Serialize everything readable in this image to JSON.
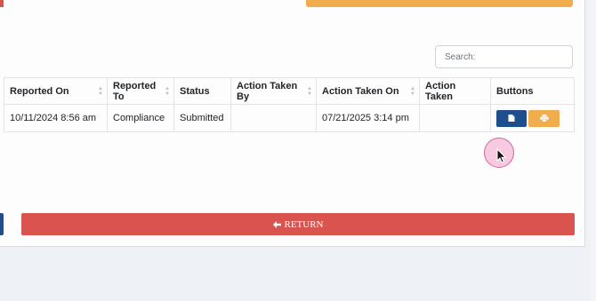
{
  "search": {
    "placeholder": "Search:"
  },
  "table": {
    "headers": [
      "Reported On",
      "Reported To",
      "Status",
      "Action Taken By",
      "Action Taken On",
      "Action Taken",
      "Buttons"
    ],
    "rows": [
      {
        "reported_on": "10/11/2024 8:56 am",
        "reported_to": "Compliance",
        "status": "Submitted",
        "action_taken_by": "",
        "action_taken_on": "07/21/2025 3:14 pm",
        "action_taken": ""
      }
    ]
  },
  "return_button": {
    "label": "RETURN"
  },
  "colors": {
    "primary": "#1f4e8c",
    "warning": "#f0ad4e",
    "danger": "#d9534f"
  }
}
